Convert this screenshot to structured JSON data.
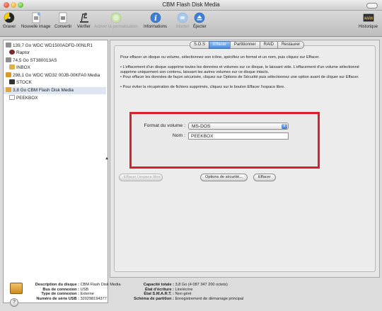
{
  "window": {
    "title": "CBM Flash Disk Media"
  },
  "toolbar": {
    "items": [
      {
        "label": "Graver",
        "icon": "burn-icon"
      },
      {
        "label": "Nouvelle image",
        "icon": "new-image-icon"
      },
      {
        "label": "Convertir",
        "icon": "convert-icon"
      },
      {
        "label": "Vérifier",
        "icon": "verify-icon"
      },
      {
        "label": "Activer la journalisation",
        "icon": "journaling-icon"
      },
      {
        "label": "Informations",
        "icon": "info-icon"
      },
      {
        "label": "Monter",
        "icon": "mount-icon"
      },
      {
        "label": "Éjecter",
        "icon": "eject-icon"
      }
    ],
    "history": {
      "label": "Historique",
      "icon": "log-icon"
    }
  },
  "sidebar": {
    "items": [
      {
        "label": "139,7 Go WDC WD1500ADFD-00NLR1",
        "icon": "hard-disk-icon",
        "color": "#8f8f8f"
      },
      {
        "label": "Raptor",
        "icon": "volume-icon",
        "color": "#7a2a2a"
      },
      {
        "label": "74,5 Go ST380013AS",
        "icon": "hard-disk-icon",
        "color": "#8f8f8f"
      },
      {
        "label": "INBOX",
        "icon": "folder-volume-icon",
        "color": "#e0b040"
      },
      {
        "label": "298,1 Go WDC WD32 00JB-00KFA0 Media",
        "icon": "external-disk-icon",
        "color": "#d79a2a"
      },
      {
        "label": "STOCK",
        "icon": "volume-icon",
        "color": "#333333"
      },
      {
        "label": "3,8 Go CBM Flash Disk Media",
        "icon": "flash-disk-icon",
        "color": "#e3a53a"
      },
      {
        "label": "PEEKBOX",
        "icon": "volume-icon",
        "color": "#ffffff"
      }
    ],
    "selected_index": 6
  },
  "tabs": [
    "S.O.S",
    "Effacer",
    "Partitionner",
    "RAID",
    "Restaurer"
  ],
  "active_tab": "Effacer",
  "erase": {
    "intro": "Pour effacer un disque ou volume, sélectionnez son icône, spécifiez un format et un nom, puis cliquez sur Effacer.",
    "bullet1": "• L’effacement d’un disque supprime toutes les données et volumes sur ce disque, le laissant vide. L’effacement d’un volume sélectionné supprime uniquement son contenu, laissant les autres volumes sur ce disque intacts.",
    "bullet2": "• Pour effacer les données de façon sécurisée, cliquez sur Options de Sécurité puis sélectionnez une option avant de cliquer sur Effacer.",
    "bullet3": "• Pour éviter la récupération de fichiers supprimés, cliquez sur le bouton Effacer l’espace libre.",
    "format_label": "Format du volume :",
    "format_value": "MS-DOS",
    "name_label": "Nom :",
    "name_value": "PEEKBOX",
    "erase_free_space": "Effacer l’espace libre",
    "security_options": "Options de sécurité...",
    "erase_button": "Effacer"
  },
  "info": {
    "left": [
      {
        "k": "Description du disque :",
        "v": "CBM Flash Disk Media"
      },
      {
        "k": "Bus de connexion :",
        "v": "USB"
      },
      {
        "k": "Type de connexion :",
        "v": "Externe"
      },
      {
        "k": "Numéro de série USB :",
        "v": "320298194377"
      }
    ],
    "right": [
      {
        "k": "Capacité totale :",
        "v": "3,8 Go (4 087 347 200 octets)"
      },
      {
        "k": "État d’écriture :",
        "v": "Lire/écrire"
      },
      {
        "k": "État S.M.A.R.T. :",
        "v": "Non géré"
      },
      {
        "k": "Schéma de partition :",
        "v": "Enregistrement de démarrage principal"
      }
    ]
  },
  "help": {
    "label": "?"
  }
}
